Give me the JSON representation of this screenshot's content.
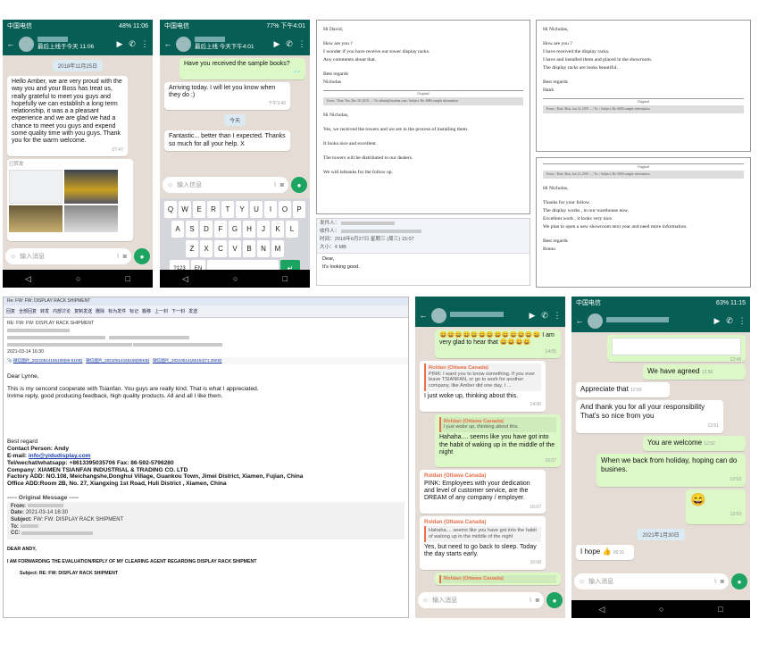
{
  "p1": {
    "status_left": "中国电信",
    "status_right": "48% 11:06",
    "header_sub": "最后上线于今天 11:06",
    "date": "2018年11月25日",
    "msg": "Hello Amber, we are very proud with the way you and your Boss has treat us, really grateful to meet you guys and hopefully we can establish a long term relationship, it was a a pleasant experience and we are glad we had a chance to meet you guys and expend some quality time with you guys. Thank you for the warm welcome.",
    "msg_time": "07:47",
    "forwarded": "已转发",
    "img_time1": "11:22",
    "img_time2": "11:22",
    "input": "输入消息"
  },
  "p2": {
    "status_left": "中国电信",
    "status_right": "77% 下午4:01",
    "header_sub": "最后上线 今天下午4:01",
    "msg1": "Have you received the sample books?",
    "msg2": "Arriving today. I will let you know when they do :)",
    "msg2_time": "下午3:40",
    "date": "今天",
    "msg3": "Fantastic... better than I expected. Thanks so much for all your help. X",
    "input": "输入信息",
    "keys_row1": [
      "Q",
      "W",
      "E",
      "R",
      "T",
      "Y",
      "U",
      "I",
      "O",
      "P"
    ],
    "keys_row2": [
      "A",
      "S",
      "D",
      "F",
      "G",
      "H",
      "J",
      "K",
      "L"
    ],
    "keys_row3": [
      "Z",
      "X",
      "C",
      "V",
      "B",
      "N",
      "M"
    ],
    "key_num": "?123",
    "key_lang": "EN"
  },
  "mail1": {
    "greeting": "Hi David,",
    "l1": "How are you ?",
    "l2": "I wonder if you have receive our tower display racks.",
    "l3": "Any comments about that.",
    "sign1": "Best regards",
    "sign2": "Nicholas",
    "orig": "Original",
    "quoted": "From: / Date: Tue, Dec 18, 2018 ... / To: admin@tsianfan.com / Subject: Re: 6006 sample information",
    "greeting2": "Hi Nicholas,",
    "r1": "Yes, we received the towers and we are in the process of installing them.",
    "r2": "It looks nice and excellent.",
    "r3": "The towers will be distributed to our dealers.",
    "r4": "We will lethanks for the follow up."
  },
  "qqmail": {
    "from": "发件人：",
    "to": "收件人：",
    "time": "时间：2018年6月27日 星期三 (周三) 15:07",
    "size": "大小：4 MB",
    "dear": "Dear,",
    "body": "It's looking good."
  },
  "mail2": {
    "greeting": "Hi Nicholas,",
    "l1": "How are you ?",
    "l2": "I have received the display racks.",
    "l3": "I have and installed them and placed in the showroom.",
    "l4": "The display racks are looks beautiful.",
    "sign1": "Best regards",
    "sign2": "Hank",
    "orig": "Original",
    "quoted": "From: / Date: Mon, Jan 14, 2019 ... / To: / Subject: Re: 6006 sample information"
  },
  "mail3": {
    "orig": "Original",
    "quoted": "From: / Date: Mon, Jan 14, 2019 ... / To: / Subject: Re: 6006 sample information",
    "greeting": "Hi Nicholas,",
    "l1": "Thanks for your follow.",
    "l2": "The display works , in our warehouse now.",
    "l3": "Excellent work , it looks very nice.",
    "l4": "We plan to open a new showroom next year and need more information.",
    "sign1": "Best regards",
    "sign2": "Bruno"
  },
  "outlook": {
    "title": "Re: FW: FW: DISPLAY RACK SHIPMENT",
    "toolbar": [
      "回复",
      "全部回复",
      "转发",
      "内部讨论",
      "复制发送",
      "删除",
      "标为发件",
      "标记",
      "搬移",
      "上一封",
      "下一封",
      "发送"
    ],
    "head_subject": "RE: FW: FW: DISPLAY RACK SHIPMENT",
    "date": "2021-03-14 16:30",
    "attach1": "微信图片_20210514165159(69.51KB)",
    "attach2": "微信图片_20210514165158(95KB)",
    "attach3": "微信图片_20210514165153(71.25KB)",
    "dear": "Dear Lynne,",
    "body1": "This is my sencond cooperate with Tsianfan. You guys are really kind. That is what I appreciated.",
    "body2": "Inrime reply, good producing feedback, high quality products. All and all I like them.",
    "best": "Best regard",
    "contact": "Contact Person: Andy",
    "email_label": "E-mail:",
    "email": "info@yidudisplay.com",
    "tel": "Tel/wechat/whatsapp: +8613395035706 Fax: 86-592-5796280",
    "company": "Company: XIAMEN TSIANFAN INDUSTRIAL & TRADING CO. LTD",
    "factory": "Factory ADD: NO.108, Meichangshe,Donghui Village, Guankou Town, Jimei District, Xiamen, Fujian, China",
    "office": "Office ADD:Room 2B, No. 27, Xiangxing 1st Road, Huli District , Xiamen, China",
    "orig_title": "----- Original Message -----",
    "f_from": "From:",
    "f_date": "Date:",
    "f_date_v": "2021-03-14 16:30",
    "f_subject": "Subject:",
    "f_subject_v": "FW: FW: DISPLAY RACK SHIPMENT",
    "f_to": "To:",
    "f_cc": "CC:",
    "dear2": "DEAR ANDY,",
    "fwd": "I AM FORWARDING THE EVALUATION/REPLY OF MY CLEARING AGENT REGARDING DISPLAY RACK SHIPMENT",
    "subject_line": "Subject: RE: FW: DISPLAY RACK SHIPMENT"
  },
  "p3": {
    "emoji_msg": "I am very glad to hear that",
    "emoji_time": "14:05",
    "q1_name": "Roldan (Ottawa Canada)",
    "q1_text": "PINK: I want you to know something. If you ever leave TSIANFAN, or go to work for another company, like Amber did one day, I ...",
    "m1": "I just woke up, thinking about this.",
    "m1_time": "14:05",
    "q2_name": "Roldan (Ottawa Canada)",
    "q2_text": "I just woke up, thinking about this.",
    "m2": "Hahaha.... seems like you have got into the habit of waking up in the middle of the night",
    "m2_time": "16:07",
    "sender": "Roldan (Ottawa Canada)",
    "m3": "PINK: Employees with your dedication and level of customer service, are the DREAM of any company / employer.",
    "m3_time": "16:07",
    "q3_name": "Roldan (Ottawa Canada)",
    "q3_text": "Hahaha.... seems like you have got into the habit of walong up in the middle of the night",
    "m4": "Yes, but need to go back to sleep. Today the day starts early.",
    "m4_time": "16:08",
    "q4_name": "Roldan (Ottawa Canada)",
    "input": "输入消息"
  },
  "p4": {
    "status_left": "中国电信",
    "status_right": "63% 11:15",
    "img_time": "12:49",
    "m1": "We have agreed",
    "m1_time": "12:50",
    "m2": "Appreciate that",
    "m2_time": "12:50",
    "m3": "And thank you for all your responsibility That's so nice from you",
    "m3_time": "12:51",
    "m4": "You are welcome",
    "m4_time": "12:52",
    "m5": "When we back from holiday, hoping can do busines.",
    "m5_time": "12:53",
    "m6_time": "12:53",
    "date": "2021年1月30日",
    "m7": "I hope",
    "m7_time": "00:31",
    "input": "输入消息"
  },
  "icons": {
    "back": "←",
    "video": "▶",
    "call": "✆",
    "more": "⋮",
    "mic": "●",
    "attach": "⌇",
    "camera": "◙",
    "emoji": "☺",
    "nav_back": "◁",
    "nav_home": "○",
    "nav_recent": "□",
    "smile": "😄",
    "thumb": "👍",
    "check": "✓✓"
  },
  "colors": {
    "wa_green": "#075e54",
    "bubble_out": "#dcf8c6",
    "chat_bg": "#e5ddd5",
    "accent": "#1da462"
  }
}
